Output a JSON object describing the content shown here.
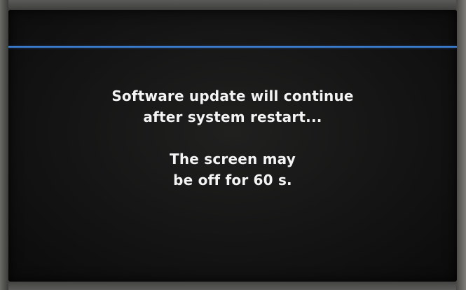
{
  "screen": {
    "accent_color": "#3f86e0",
    "message_lines_1": [
      "Software update will continue",
      "after system restart..."
    ],
    "message_lines_2": [
      "The screen may",
      "be off for 60 s."
    ]
  }
}
